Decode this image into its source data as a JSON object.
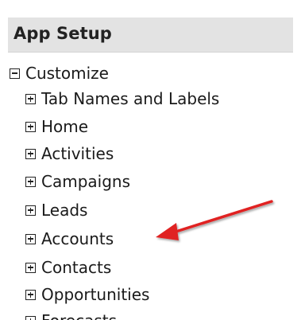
{
  "setup": {
    "header_title": "App Setup",
    "tree": {
      "root_label": "Customize",
      "items": [
        {
          "label": "Tab Names and Labels"
        },
        {
          "label": "Home"
        },
        {
          "label": "Activities"
        },
        {
          "label": "Campaigns"
        },
        {
          "label": "Leads"
        },
        {
          "label": "Accounts"
        },
        {
          "label": "Contacts"
        },
        {
          "label": "Opportunities"
        },
        {
          "label": "Forecasts"
        }
      ]
    }
  },
  "annotation": {
    "arrow_color": "#e02020",
    "arrow_target": "Accounts"
  }
}
